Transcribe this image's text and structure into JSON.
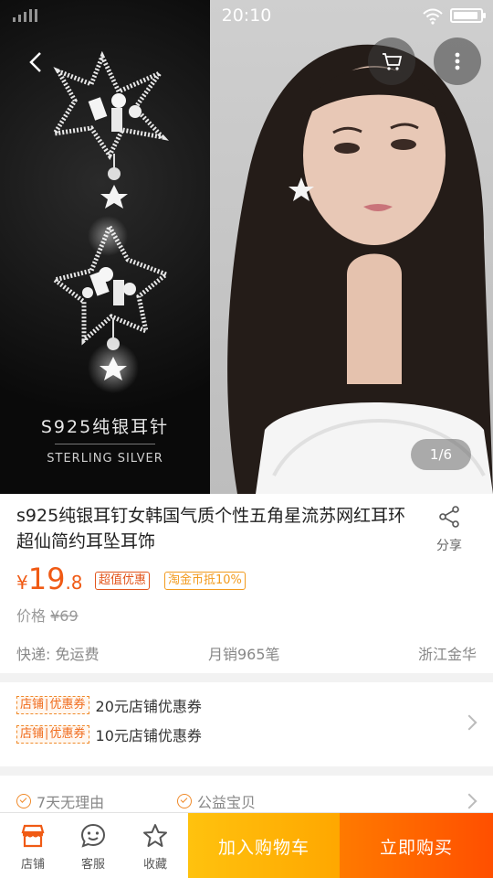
{
  "status_bar": {
    "time": "20:10",
    "battery_level": 0.93
  },
  "gallery": {
    "caption_main": "S925纯银耳针",
    "caption_sub": "STERLING SILVER",
    "page_indicator": "1/6"
  },
  "product": {
    "title": "s925纯银耳钉女韩国气质个性五角星流苏网红耳环超仙简约耳坠耳饰",
    "share_label": "分享",
    "price_currency": "¥",
    "price_integer": "19",
    "price_decimal": ".8",
    "tag_value": "超值优惠",
    "tag_coin": "淘金币抵10%",
    "original_price_label": "价格",
    "original_price": "¥69",
    "shipping": "快递: 免运费",
    "monthly_sales": "月销965笔",
    "location": "浙江金华"
  },
  "coupons": [
    {
      "tag": "店铺∣优惠券",
      "text": "20元店铺优惠券"
    },
    {
      "tag": "店铺∣优惠券",
      "text": "10元店铺优惠券"
    }
  ],
  "services": [
    {
      "label": "7天无理由"
    },
    {
      "label": "公益宝贝"
    }
  ],
  "bottom_bar": {
    "store": "店铺",
    "service": "客服",
    "favorite": "收藏",
    "add_to_cart": "加入购物车",
    "buy_now": "立即购买"
  },
  "colors": {
    "accent": "#f05a14",
    "cart_button": "#ffb300",
    "buy_button": "#ff5a00"
  }
}
